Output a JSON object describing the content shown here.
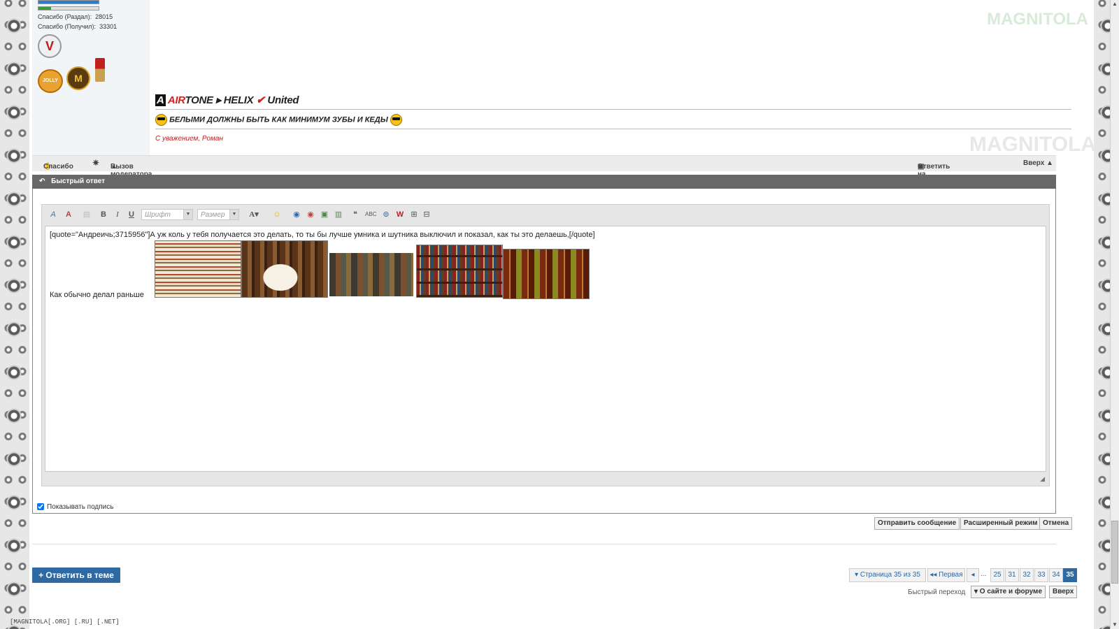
{
  "user": {
    "thanks_section_label": "Спасибо (Раздал):",
    "thanks_section_value": "28015",
    "thanks_received_label": "Спасибо (Получил):",
    "thanks_received_value": "33301",
    "avatar_letter": "V",
    "medal_1_text": "JOLLY",
    "medal_2_text": "M"
  },
  "signature": {
    "logo_parts": [
      "AIR",
      "TONE",
      "HELIX",
      "United"
    ],
    "slogan": "БЕЛЫМИ ДОЛЖНЫ БЫТЬ КАК МИНИМУМ ЗУБЫ И КЕДЫ",
    "regards": "С уважением, Роман"
  },
  "watermark": "MAGNITOLA",
  "actions": {
    "thanks": "Спасибо",
    "report": "Вызов модератора",
    "reply_to_post": "Ответить на сообщение",
    "top": "Вверх ▲"
  },
  "quick_reply": {
    "title": "Быстрый ответ",
    "font_placeholder": "Шрифт",
    "size_placeholder": "Размер",
    "quote_line": "[quote=\"Андреичь;3715956\"]А уж коль у тебя получается это делать, то ты бы лучше умника и шутника выключил и показал, как ты это делаешь,[/quote]",
    "body_text": "Как обычно делал раньше",
    "show_signature": "Показывать подпись",
    "submit": "Отправить сообщение",
    "advanced": "Расширенный режим",
    "cancel": "Отмена"
  },
  "bottom": {
    "reply_in_thread": "+ Ответить в теме",
    "page_info": "▾ Страница 35 из 35",
    "first": "◂◂ Первая",
    "prev": "◂",
    "ellipsis": "...",
    "pages": [
      "25",
      "31",
      "32",
      "33",
      "34",
      "35"
    ],
    "quick_jump_label": "Быстрый переход",
    "quick_jump_value": "▾ О сайте и форуме",
    "top": "Вверх"
  },
  "footer_text": "[MAGNITOLA[.ORG] [.RU] [.NET]",
  "colors": {
    "accent": "#2d6aa3",
    "header_bar": "#676767",
    "signature_red": "#d42020"
  }
}
